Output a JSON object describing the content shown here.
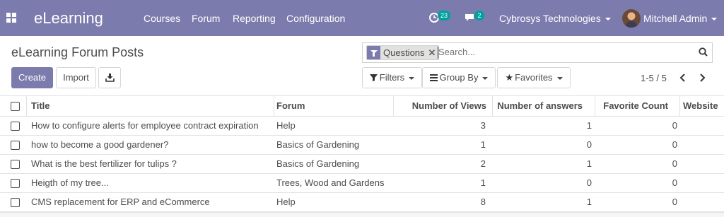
{
  "navbar": {
    "brand": "eLearning",
    "menu": [
      "Courses",
      "Forum",
      "Reporting",
      "Configuration"
    ],
    "activity_count": "23",
    "message_count": "2",
    "company": "Cybrosys Technologies",
    "user": "Mitchell Admin",
    "color": "#7c7bad",
    "badge_color": "#00a09d"
  },
  "control_panel": {
    "title": "eLearning Forum Posts",
    "create_label": "Create",
    "import_label": "Import",
    "download_icon": "download-icon",
    "search": {
      "facet": "Questions",
      "placeholder": "Search..."
    },
    "filters_label": "Filters",
    "group_by_label": "Group By",
    "favorites_label": "Favorites",
    "pager": "1-5 / 5"
  },
  "table": {
    "columns": [
      "Title",
      "Forum",
      "Number of Views",
      "Number of answers",
      "Favorite Count",
      "Website"
    ],
    "rows": [
      {
        "title": "How to configure alerts for employee contract expiration",
        "forum": "Help",
        "views": "3",
        "answers": "1",
        "favorites": "0",
        "website": ""
      },
      {
        "title": "how to become a good gardener?",
        "forum": "Basics of Gardening",
        "views": "1",
        "answers": "0",
        "favorites": "0",
        "website": ""
      },
      {
        "title": "What is the best fertilizer for tulips ?",
        "forum": "Basics of Gardening",
        "views": "2",
        "answers": "1",
        "favorites": "0",
        "website": ""
      },
      {
        "title": "Heigth of my tree...",
        "forum": "Trees, Wood and Gardens",
        "views": "1",
        "answers": "0",
        "favorites": "0",
        "website": ""
      },
      {
        "title": "CMS replacement for ERP and eCommerce",
        "forum": "Help",
        "views": "8",
        "answers": "1",
        "favorites": "0",
        "website": ""
      }
    ]
  }
}
